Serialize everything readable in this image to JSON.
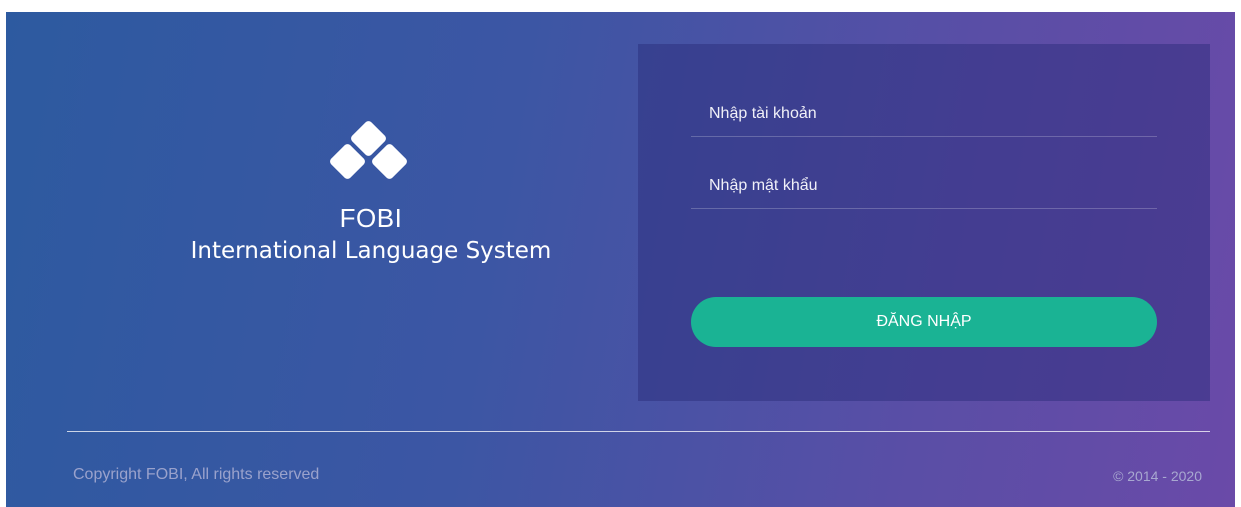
{
  "brand": {
    "name": "FOBI",
    "tagline": "International Language System",
    "logo_icon": "fobi-diamond-logo-icon"
  },
  "login": {
    "username_placeholder": "Nhập tài khoản",
    "password_placeholder": "Nhập mật khẩu",
    "submit_label": "ĐĂNG NHẬP"
  },
  "footer": {
    "copyright": "Copyright FOBI, All rights reserved",
    "years": "© 2014 - 2020"
  },
  "colors": {
    "accent": "#1ab394",
    "background_start": "#2d5aa0",
    "background_end": "#6a4aa8"
  }
}
